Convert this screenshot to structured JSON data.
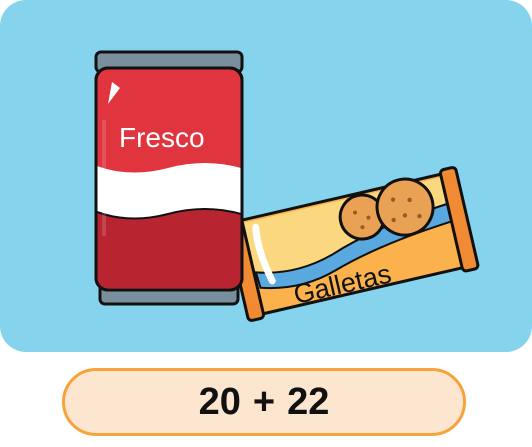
{
  "illustration": {
    "can_label": "Fresco",
    "package_label": "Galletas"
  },
  "expression": {
    "left": "20",
    "operator": "+",
    "right": "22"
  },
  "colors": {
    "panel_bg": "#85d3ec",
    "can_red": "#e0353f",
    "can_dark_red": "#b82430",
    "lid_gray": "#7a8f9e",
    "package_orange": "#fbb24c",
    "package_yellow": "#fbd77f",
    "cookie": "#e9a154",
    "pill_bg": "#fde6cf",
    "pill_border": "#f7a23a"
  }
}
